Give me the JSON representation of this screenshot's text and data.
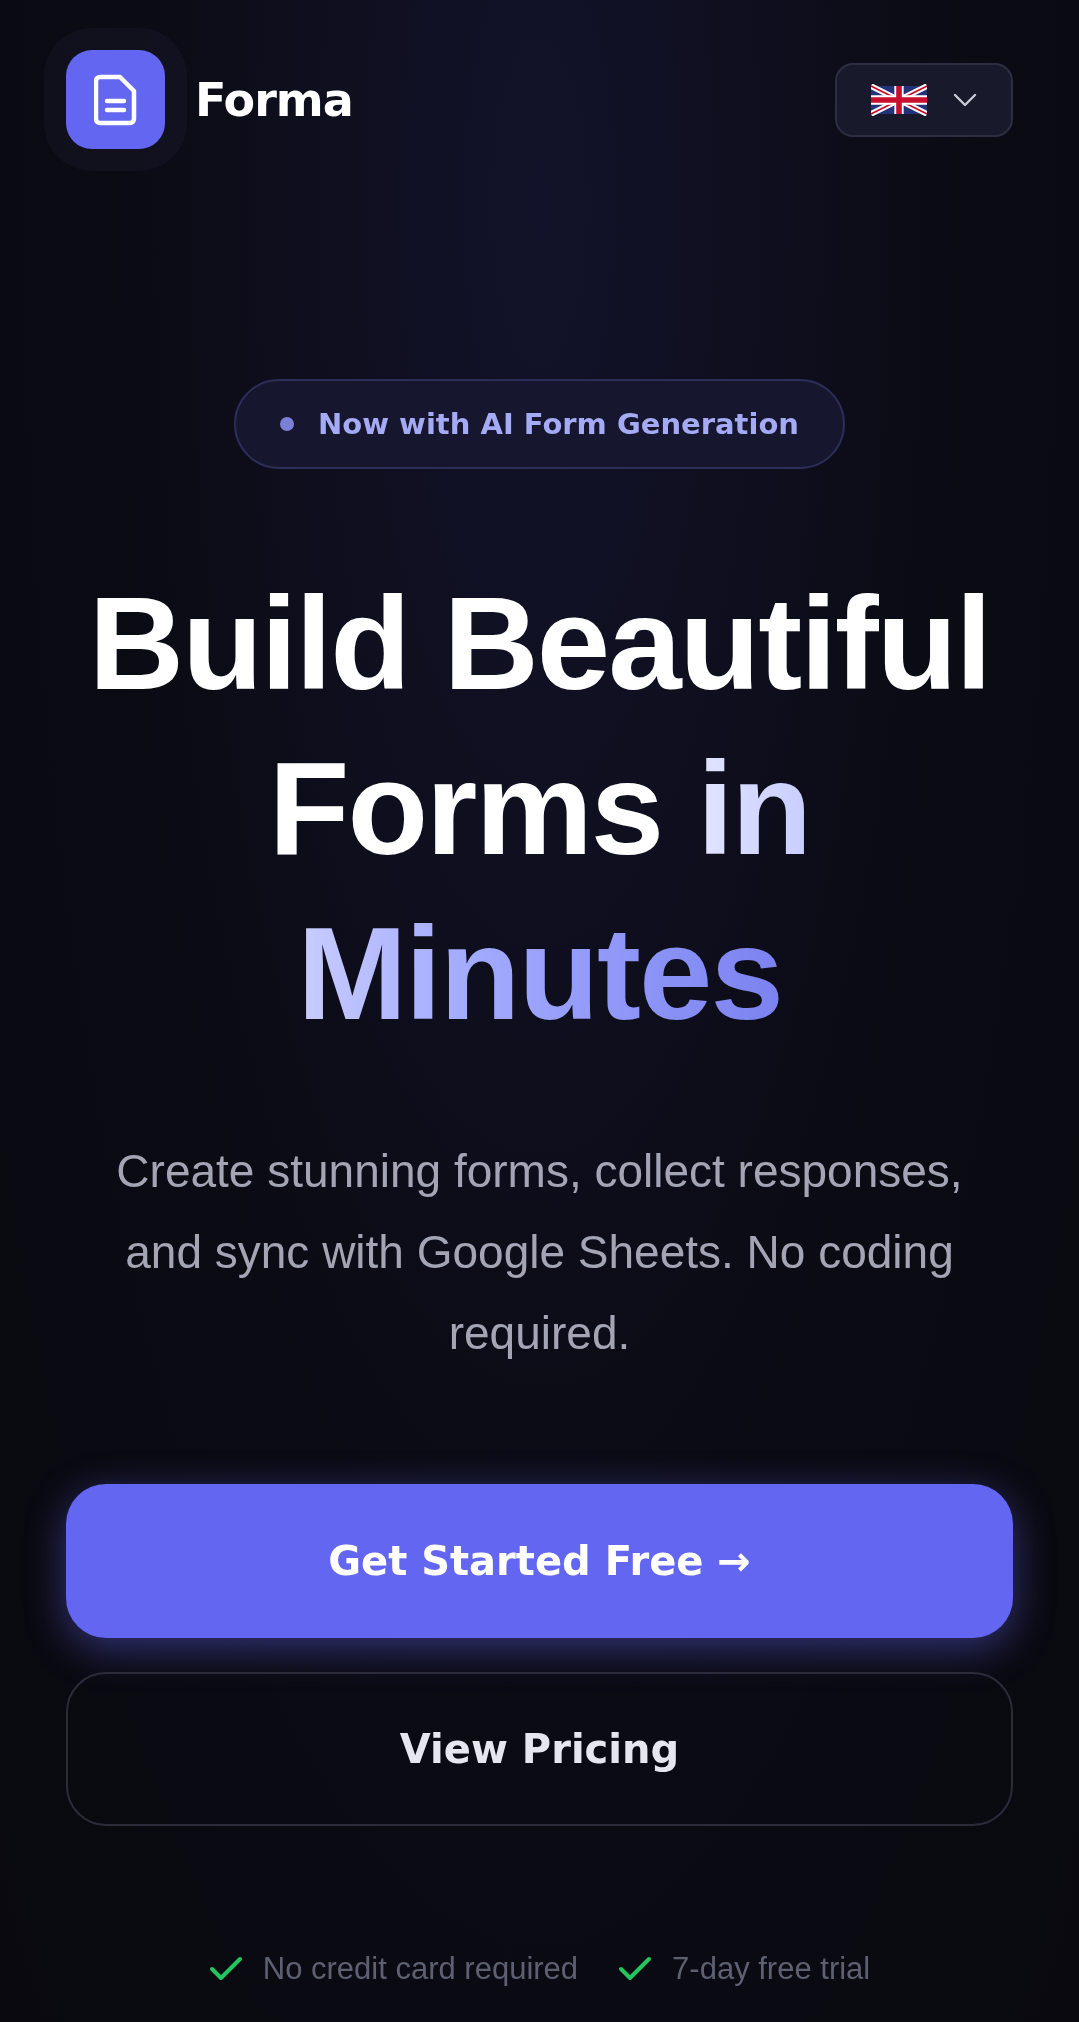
{
  "brand": {
    "name": "Forma"
  },
  "badge": {
    "text": "Now with AI Form Generation"
  },
  "headline": {
    "text": "Build Beautiful Forms",
    "accent": "in Minutes"
  },
  "subtitle": "Create stunning forms, collect responses, and sync with Google Sheets. No coding required.",
  "buttons": [
    {
      "label": "Get Started Free →",
      "kind": "primary"
    },
    {
      "label": "View Pricing",
      "kind": "secondary"
    }
  ],
  "perks": [
    "No credit card required",
    "7-day free trial"
  ]
}
